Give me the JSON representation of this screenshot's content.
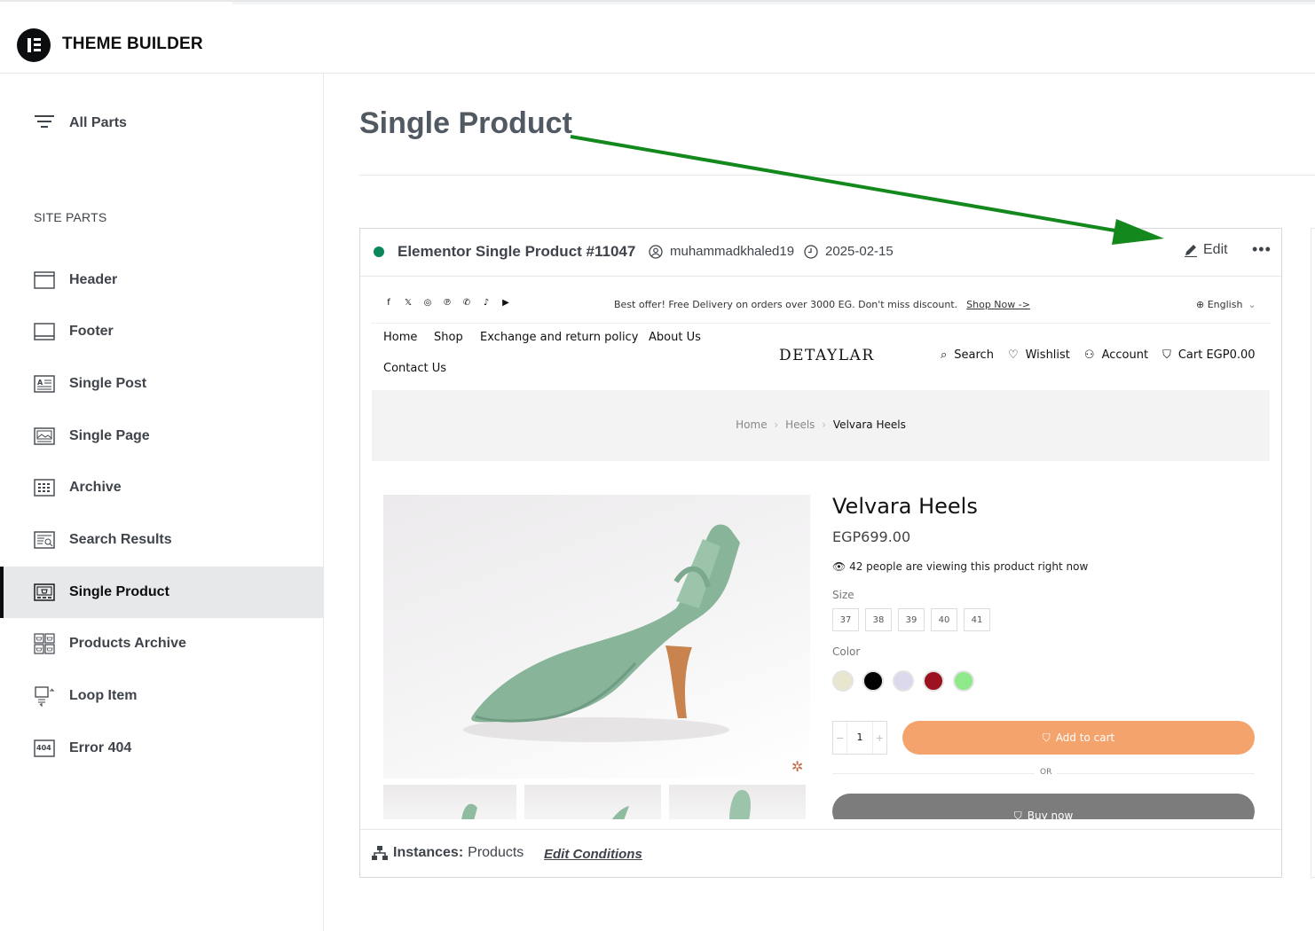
{
  "app": {
    "title": "THEME BUILDER"
  },
  "sidebar": {
    "all_parts": "All Parts",
    "section_label": "SITE PARTS",
    "items": [
      {
        "label": "Header",
        "icon": "header-icon"
      },
      {
        "label": "Footer",
        "icon": "footer-icon"
      },
      {
        "label": "Single Post",
        "icon": "single-post-icon"
      },
      {
        "label": "Single Page",
        "icon": "single-page-icon"
      },
      {
        "label": "Archive",
        "icon": "archive-icon"
      },
      {
        "label": "Search Results",
        "icon": "search-results-icon"
      },
      {
        "label": "Single Product",
        "icon": "single-product-icon",
        "active": true
      },
      {
        "label": "Products Archive",
        "icon": "products-archive-icon"
      },
      {
        "label": "Loop Item",
        "icon": "loop-item-icon"
      },
      {
        "label": "Error 404",
        "icon": "error-404-icon",
        "badge": "404"
      }
    ]
  },
  "main": {
    "title": "Single Product"
  },
  "card": {
    "status_color": "#0a875a",
    "title": "Elementor Single Product #11047",
    "author": "muhammadkhaled19",
    "date": "2025-02-15",
    "edit_label": "Edit",
    "more_label": "•••",
    "instances_label": "Instances:",
    "instances_value": "Products",
    "edit_conditions": "Edit Conditions"
  },
  "preview": {
    "social_icons": [
      "f",
      "𝕏",
      "◎",
      "℗",
      "✆",
      "♪",
      "▶"
    ],
    "promo_text": "Best offer! Free Delivery on orders over 3000 EG. Don't miss discount.",
    "promo_link": "Shop Now ->",
    "language": "English",
    "menu": [
      "Home",
      "Shop",
      "Exchange and return policy",
      "About Us",
      "Contact Us"
    ],
    "brand": "DETAYLAR",
    "header_links": {
      "search": "Search",
      "wishlist": "Wishlist",
      "account": "Account",
      "cart": "Cart EGP0.00"
    },
    "breadcrumb": [
      "Home",
      "Heels",
      "Velvara Heels"
    ],
    "breadcrumb_sep": "›",
    "product": {
      "name": "Velvara Heels",
      "price": "EGP699.00",
      "viewers": "42 people are viewing this product right now",
      "size_label": "Size",
      "sizes": [
        "37",
        "38",
        "39",
        "40",
        "41"
      ],
      "color_label": "Color",
      "colors": [
        "#e8e6cf",
        "#000000",
        "#dcd9ec",
        "#9b1320",
        "#8fe88a"
      ],
      "quantity": "1",
      "qty_minus": "−",
      "qty_plus": "+",
      "add_to_cart": "Add to cart",
      "or": "OR",
      "buy_now": "Buy now"
    }
  },
  "colors": {
    "accent_arrow": "#13891d",
    "add_to_cart": "#f4a36c",
    "buy_now": "#7c7c7c"
  }
}
